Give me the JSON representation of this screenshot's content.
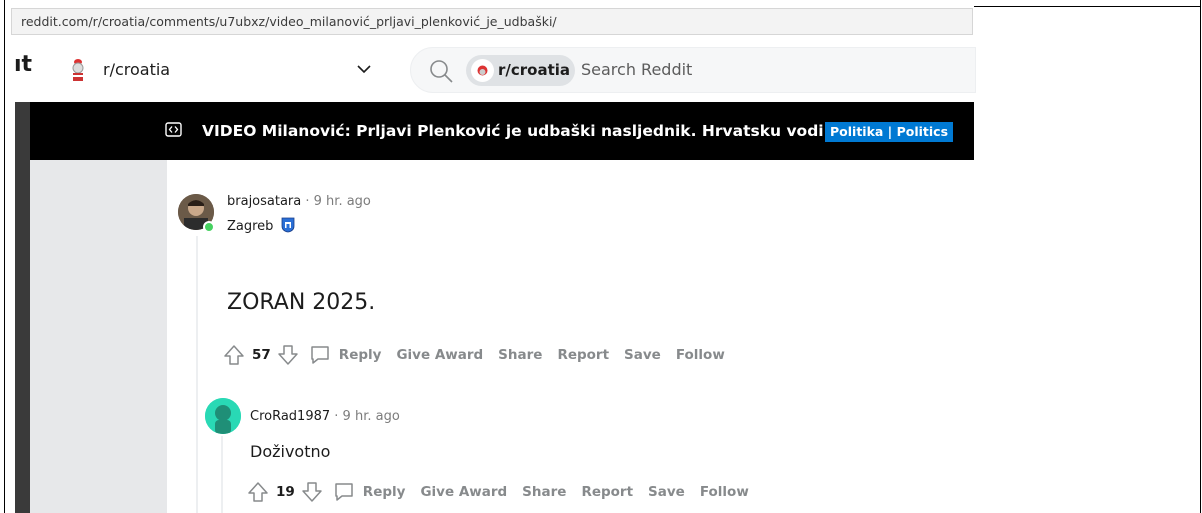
{
  "browser": {
    "url": "reddit.com/r/croatia/comments/u7ubxz/video_milanović_prljavi_plenković_je_udbaški/"
  },
  "header": {
    "subreddit_name": "r/croatia",
    "search_chip": "r/croatia",
    "search_placeholder": "Search Reddit"
  },
  "post": {
    "title": "VIDEO Milanović: Prljavi Plenković je udbaški nasljednik. Hrvatsku vodi banda",
    "flair": "Politika | Politics"
  },
  "comments": [
    {
      "author": "brajosatara",
      "time": "· 9 hr. ago",
      "user_flair": "Zagreb",
      "body": "ZORAN 2025.",
      "votes": "57",
      "actions": [
        "Reply",
        "Give Award",
        "Share",
        "Report",
        "Save",
        "Follow"
      ]
    },
    {
      "author": "CroRad1987",
      "time": "· 9 hr. ago",
      "body": "Doživotno",
      "votes": "19",
      "actions": [
        "Reply",
        "Give Award",
        "Share",
        "Report",
        "Save",
        "Follow"
      ]
    }
  ],
  "colors": {
    "flair_bg": "#0079d3",
    "online": "#46d160",
    "post_bar": "#000000"
  }
}
